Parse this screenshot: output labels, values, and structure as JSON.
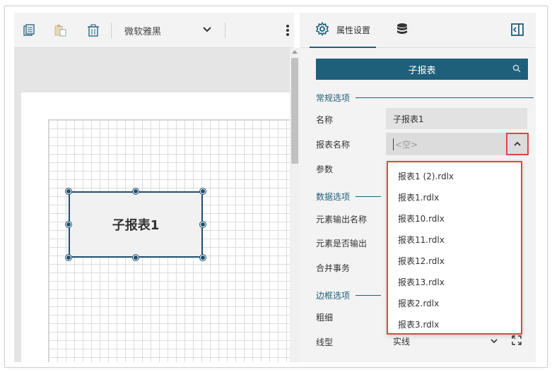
{
  "toolbar": {
    "icons": [
      "copy-icon",
      "paste-icon",
      "delete-icon",
      "more-vertical-icon"
    ],
    "font_value": "微软雅黑"
  },
  "canvas": {
    "subreport_label": "子报表1"
  },
  "panel": {
    "tab_properties_label": "属性设置",
    "search_label": "子报表",
    "sections": {
      "general": "常规选项",
      "data": "数据选项",
      "border": "边框选项"
    },
    "labels": {
      "name": "名称",
      "report_name": "报表名称",
      "parameters": "参数",
      "element_output_name": "元素输出名称",
      "element_output": "元素是否输出",
      "merge_transaction": "合并事务",
      "thickness": "粗细",
      "line_type": "线型"
    },
    "name_value": "子报表1",
    "report_name_placeholder": "<空>",
    "line_type_value": "实线",
    "dropdown_options": [
      "报表1 (2).rdlx",
      "报表1.rdlx",
      "报表10.rdlx",
      "报表11.rdlx",
      "报表12.rdlx",
      "报表13.rdlx",
      "报表2.rdlx",
      "报表3.rdlx"
    ]
  },
  "colors": {
    "accent": "#1e5f7a",
    "highlight": "#e04545",
    "selection_border": "#1e4e6e"
  }
}
